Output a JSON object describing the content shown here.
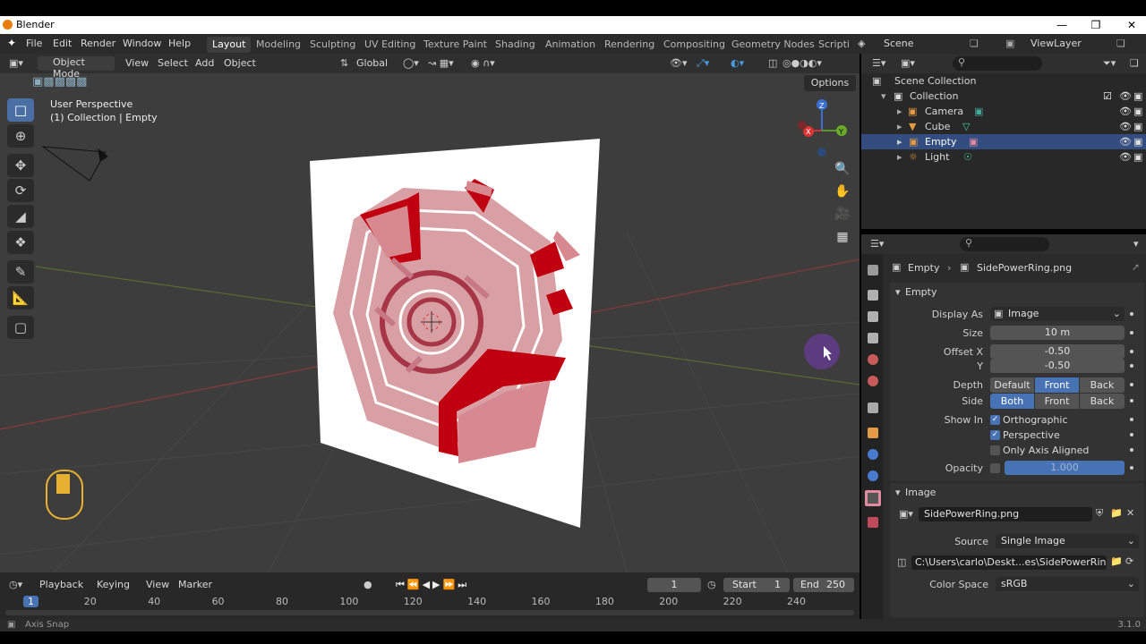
{
  "app": {
    "title": "Blender",
    "version": "3.1.0"
  },
  "menu": [
    "File",
    "Edit",
    "Render",
    "Window",
    "Help"
  ],
  "workspaces": [
    "Layout",
    "Modeling",
    "Sculpting",
    "UV Editing",
    "Texture Paint",
    "Shading",
    "Animation",
    "Rendering",
    "Compositing",
    "Geometry Nodes",
    "Scripti"
  ],
  "scene": {
    "label": "Scene",
    "viewlayer": "ViewLayer"
  },
  "viewport": {
    "mode": "Object Mode",
    "menus": [
      "View",
      "Select",
      "Add",
      "Object"
    ],
    "orientation": "Global",
    "options": "Options",
    "overlay_line1": "User Perspective",
    "overlay_line2": "(1) Collection | Empty"
  },
  "outliner": {
    "root": "Scene Collection",
    "collection": "Collection",
    "items": [
      {
        "name": "Camera",
        "icon": "camera-icon"
      },
      {
        "name": "Cube",
        "icon": "mesh-icon"
      },
      {
        "name": "Empty",
        "icon": "empty-image-icon",
        "selected": true
      },
      {
        "name": "Light",
        "icon": "light-icon"
      }
    ]
  },
  "properties": {
    "breadcrumb_object": "Empty",
    "breadcrumb_data": "SidePowerRing.png",
    "empty_panel": "Empty",
    "display_as_label": "Display As",
    "display_as": "Image",
    "size_label": "Size",
    "size": "10 m",
    "offset_x_label": "Offset X",
    "offset_x": "-0.50",
    "offset_y_label": "Y",
    "offset_y": "-0.50",
    "depth_label": "Depth",
    "depth_options": [
      "Default",
      "Front",
      "Back"
    ],
    "depth_selected": "Front",
    "side_label": "Side",
    "side_options": [
      "Both",
      "Front",
      "Back"
    ],
    "side_selected": "Both",
    "show_in_label": "Show In",
    "orthographic": "Orthographic",
    "perspective": "Perspective",
    "axis_aligned": "Only Axis Aligned",
    "opacity_label": "Opacity",
    "opacity": "1.000",
    "image_panel": "Image",
    "image_name": "SidePowerRing.png",
    "source_label": "Source",
    "source": "Single Image",
    "filepath": "C:\\Users\\carlo\\Deskt...es\\SidePowerRing.png",
    "colorspace_label": "Color Space",
    "colorspace": "sRGB"
  },
  "timeline": {
    "menus": [
      "Playback",
      "Keying",
      "View",
      "Marker"
    ],
    "current_frame": "1",
    "start_label": "Start",
    "start": "1",
    "end_label": "End",
    "end": "250",
    "ticks": [
      "1",
      "20",
      "40",
      "60",
      "80",
      "100",
      "120",
      "140",
      "160",
      "180",
      "200",
      "220",
      "240"
    ]
  },
  "status": {
    "left": "Axis Snap",
    "version": "3.1.0"
  },
  "colors": {
    "accent": "#4772b3",
    "selection": "#334d80",
    "ring_red": "#c00010",
    "ring_pink": "#d8a0a4"
  }
}
